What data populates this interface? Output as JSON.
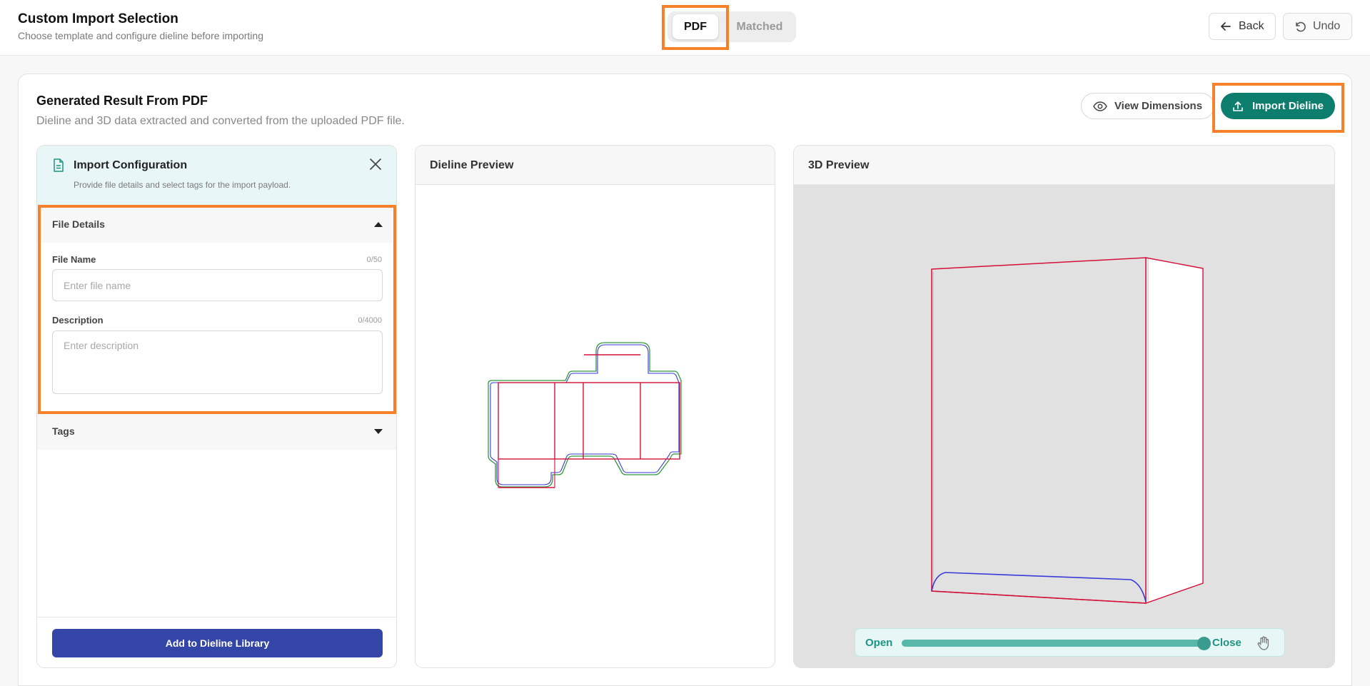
{
  "header": {
    "title": "Custom Import Selection",
    "subtitle": "Choose template and configure dieline before importing",
    "mode_tabs": [
      {
        "label": "PDF",
        "selected": true
      },
      {
        "label": "Matched",
        "selected": false
      }
    ],
    "back_label": "Back",
    "undo_label": "Undo"
  },
  "result": {
    "title": "Generated Result From PDF",
    "subtitle": "Dieline and 3D data extracted and converted from the uploaded PDF file.",
    "view_dimensions_label": "View Dimensions",
    "import_label": "Import Dieline"
  },
  "config": {
    "title": "Import Configuration",
    "subtitle": "Provide file details and select tags for the import payload.",
    "file_details_label": "File Details",
    "file_details_expanded": true,
    "file_name_label": "File Name",
    "file_name_count": "0/50",
    "file_name_value": "",
    "file_name_placeholder": "Enter file name",
    "description_label": "Description",
    "description_count": "0/4000",
    "description_value": "",
    "description_placeholder": "Enter description",
    "tags_label": "Tags",
    "tags_expanded": false,
    "add_library_label": "Add to Dieline Library"
  },
  "dieline_preview": {
    "title": "Dieline Preview"
  },
  "preview_3d": {
    "title": "3D Preview",
    "open_label": "Open",
    "close_label": "Close",
    "fold_level": 1.0
  },
  "colors": {
    "accent_teal": "#0d7d6d",
    "primary_blue": "#3346a8",
    "highlight_orange": "#f5822a",
    "cut_line": "#d4103a",
    "crease_line": "#2b2be0",
    "bleed_line": "#2e9a3c"
  },
  "icons": {
    "back": "arrow-left-icon",
    "undo": "undo-icon",
    "view_dimensions": "eye-icon",
    "import": "upload-icon",
    "config": "document-icon",
    "close": "close-icon",
    "file_details_toggle": "caret-up-icon",
    "tags_toggle": "caret-down-icon",
    "drag": "hand-icon"
  }
}
